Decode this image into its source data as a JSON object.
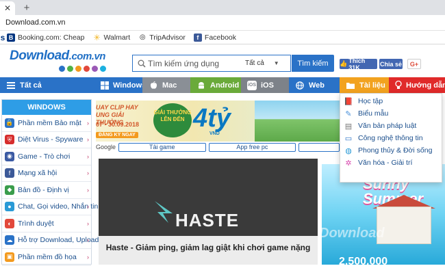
{
  "browser": {
    "url": "Download.com.vn",
    "bookmarks": [
      {
        "label": "Booking.com: Cheap",
        "icon": "booking-icon"
      },
      {
        "label": "Walmart",
        "icon": "walmart-icon"
      },
      {
        "label": "TripAdvisor",
        "icon": "tripadvisor-icon"
      },
      {
        "label": "Facebook",
        "icon": "facebook-icon"
      }
    ]
  },
  "site": {
    "logo_main": "Download",
    "logo_domain": ".com.vn",
    "logo_dot_colors": [
      "#2a72c7",
      "#4fb248",
      "#f39a1e",
      "#e2483b",
      "#9b59b6",
      "#1bb0e0"
    ],
    "search": {
      "placeholder": "Tìm kiếm ứng dụng",
      "scope": "Tất cả",
      "button": "Tìm kiếm"
    },
    "social": {
      "like": "Thích 31K",
      "share": "Chia sẻ",
      "gplus": "G+"
    }
  },
  "nav": [
    {
      "label": "Tất cả",
      "icon": "menu-icon",
      "color": "#2a72c7"
    },
    {
      "label": "Windows",
      "icon": "windows-icon",
      "color": "#2a72c7"
    },
    {
      "label": "Mac",
      "icon": "apple-icon",
      "color": "#8a8f96"
    },
    {
      "label": "Android",
      "icon": "android-icon",
      "color": "#6aaa3a"
    },
    {
      "label": "iOS",
      "icon": "ios-icon",
      "color": "#7d8289"
    },
    {
      "label": "Web",
      "icon": "web-icon",
      "color": "#2a72c7"
    },
    {
      "label": "Tài liệu",
      "icon": "folder-icon",
      "color": "#f2a21f"
    },
    {
      "label": "Hướng dẫn",
      "icon": "lightbulb-icon",
      "color": "#e02a2a"
    }
  ],
  "sidebar": {
    "header": "WINDOWS",
    "items": [
      {
        "label": "Phần mềm Bảo mật",
        "icon": "lock-icon",
        "color": "#2a72c7"
      },
      {
        "label": "Diệt Virus - Spyware",
        "icon": "shield-icon",
        "color": "#d62d2d"
      },
      {
        "label": "Game - Trò chơi",
        "icon": "gamepad-icon",
        "color": "#3b5aa3"
      },
      {
        "label": "Mạng xã hội",
        "icon": "facebook-icon",
        "color": "#3b5998"
      },
      {
        "label": "Bản đồ - Định vị",
        "icon": "map-icon",
        "color": "#3a9d4c"
      },
      {
        "label": "Chat, Gọi video, Nhắn tin",
        "icon": "chat-icon",
        "color": "#2a9ad6"
      },
      {
        "label": "Trình duyệt",
        "icon": "browser-icon",
        "color": "#e2483b"
      },
      {
        "label": "Hỗ trợ Download, Upload",
        "icon": "cloud-icon",
        "color": "#2a72c7"
      },
      {
        "label": "Phần mềm đồ họa",
        "icon": "image-icon",
        "color": "#f39a1e"
      }
    ]
  },
  "banner": {
    "tagline": "UAY CLIP HAY UNG GIẢI THƯỞNG",
    "dates": "07 - 30.09.2018",
    "cta": "ĐĂNG KÝ NGAY",
    "badge": "GIẢI THƯỞNG LÊN ĐẾN",
    "amount": "4tỷ",
    "currency": "VND",
    "sub_prefix": "Google",
    "sub_tabs": [
      "Tải game",
      "App free pc"
    ]
  },
  "feature": {
    "brand": "HASTE",
    "caption": "Haste - Giảm ping, giảm lag giật khi chơi game nặng"
  },
  "promo": {
    "title": "Sunny Summer",
    "watermark": "Download",
    "number": "2.500.000"
  },
  "dropdown": [
    {
      "label": "Học tập",
      "icon": "book-icon",
      "color": "#e2483b"
    },
    {
      "label": "Biểu mẫu",
      "icon": "form-icon",
      "color": "#4a90d9"
    },
    {
      "label": "Văn bản pháp luật",
      "icon": "document-icon",
      "color": "#7a7a7a"
    },
    {
      "label": "Công nghệ thông tin",
      "icon": "monitor-icon",
      "color": "#2a72c7"
    },
    {
      "label": "Phong thủy & Đời sống",
      "icon": "globe-icon",
      "color": "#2a9ad6"
    },
    {
      "label": "Văn hóa - Giải trí",
      "icon": "sparkle-icon",
      "color": "#d94bb0"
    }
  ]
}
